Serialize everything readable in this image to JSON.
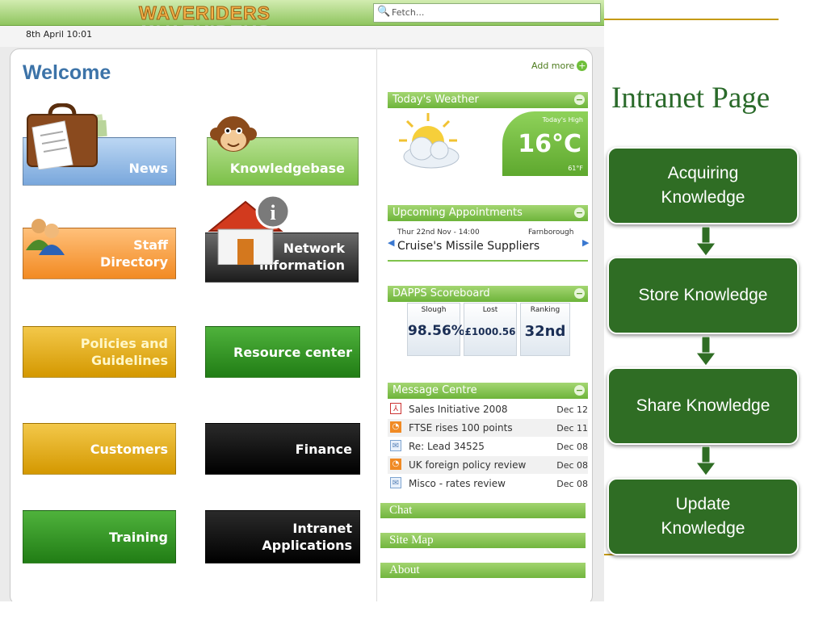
{
  "intranet": {
    "logo": "WAVERIDERS",
    "search_placeholder": "Fetch...",
    "date_time": "8th April  10:01",
    "welcome": "Welcome",
    "tiles": {
      "news": "News",
      "knowledgebase": "Knowledgebase",
      "staff_directory": [
        "Staff",
        "Directory"
      ],
      "network_information": [
        "Network",
        "Information"
      ],
      "policies": [
        "Policies and",
        "Guidelines"
      ],
      "resource_center": "Resource center",
      "customers": "Customers",
      "finance": "Finance",
      "training": "Training",
      "intranet_applications": [
        "Intranet",
        "Applications"
      ]
    },
    "add_more": "Add more",
    "weather": {
      "header": "Today's Weather",
      "high_label": "Today's High",
      "temp_c": "16°C",
      "temp_f": "61°F"
    },
    "appointments": {
      "header": "Upcoming Appointments",
      "date": "Thur 22nd Nov - 14:00",
      "place": "Farnborough",
      "title": "Cruise's Missile Suppliers"
    },
    "scoreboard": {
      "header": "DAPPS Scoreboard",
      "items": [
        {
          "label": "Slough",
          "value": "98.56%"
        },
        {
          "label": "Lost",
          "value": "£1000.56"
        },
        {
          "label": "Ranking",
          "value": "32nd"
        }
      ]
    },
    "messages": {
      "header": "Message Centre",
      "rows": [
        {
          "icon": "pdf-icon",
          "subject": "Sales Initiative 2008",
          "date": "Dec 12"
        },
        {
          "icon": "rss-icon",
          "subject": "FTSE rises 100 points",
          "date": "Dec 11"
        },
        {
          "icon": "mail-icon",
          "subject": "Re: Lead 34525",
          "date": "Dec 08"
        },
        {
          "icon": "rss-icon",
          "subject": "UK foreign policy review",
          "date": "Dec 08"
        },
        {
          "icon": "mail-icon",
          "subject": "Misco - rates review",
          "date": "Dec 08"
        }
      ]
    },
    "links": [
      "Chat",
      "Site Map",
      "About"
    ]
  },
  "slide": {
    "title": "Intranet Page",
    "steps": [
      [
        "Acquiring",
        "Knowledge"
      ],
      [
        "Store Knowledge"
      ],
      [
        "Share Knowledge"
      ],
      [
        "Update",
        "Knowledge"
      ]
    ]
  },
  "colors": {
    "accent_green": "#2f6d24",
    "welcome_blue": "#3c73a8",
    "widget_green": "#7cc048",
    "slide_line_gold": "#c49a14"
  }
}
